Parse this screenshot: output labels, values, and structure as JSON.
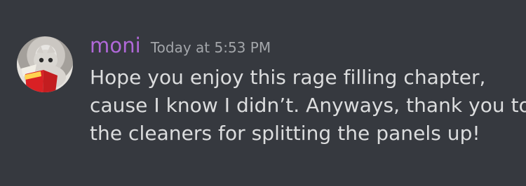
{
  "message": {
    "username": "moni",
    "timestamp": "Today at 5:53 PM",
    "lines": [
      "Hope you enjoy this rage filling chapter,",
      "cause I know I didn’t. Anyways, thank you to",
      "the cleaners for splitting the panels up!"
    ],
    "avatar_icon": "cat-avatar-icon"
  },
  "colors": {
    "background": "#36393f",
    "username": "#b068d8",
    "text": "#dcddde",
    "timestamp": "#a3a6aa"
  }
}
